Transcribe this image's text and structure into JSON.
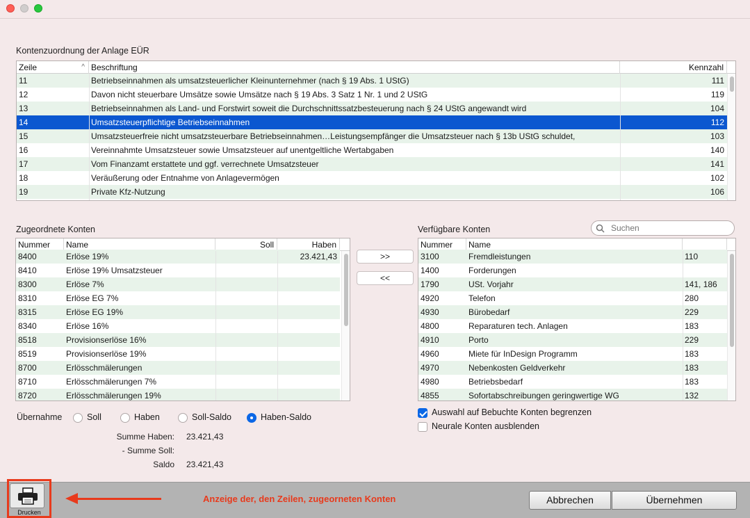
{
  "anlage": {
    "title": "Kontenzuordnung der Anlage EÜR",
    "headers": {
      "zeile": "Zeile",
      "beschriftung": "Beschriftung",
      "kennzahl": "Kennzahl"
    },
    "rows": [
      {
        "zeile": "11",
        "text": "Betriebseinnahmen als umsatzsteuerlicher Kleinunternehmer (nach § 19 Abs. 1 UStG)",
        "kz": "111"
      },
      {
        "zeile": "12",
        "text": "Davon nicht steuerbare Umsätze sowie Umsätze nach § 19 Abs. 3 Satz 1 Nr. 1 und 2 UStG",
        "kz": "119"
      },
      {
        "zeile": "13",
        "text": "Betriebseinnahmen als Land- und Forstwirt  soweit die Durchschnittssatzbesteuerung nach § 24 UStG angewandt wird",
        "kz": "104"
      },
      {
        "zeile": "14",
        "text": "Umsatzsteuerpflichtige Betriebseinnahmen",
        "kz": "112",
        "selected": true
      },
      {
        "zeile": "15",
        "text": "Umsatzsteuerfreie  nicht umsatzsteuerbare Betriebseinnahmen…Leistungsempfänger die Umsatzsteuer nach § 13b UStG schuldet,",
        "kz": "103"
      },
      {
        "zeile": "16",
        "text": "Vereinnahmte Umsatzsteuer sowie Umsatzsteuer auf unentgeltliche Wertabgaben",
        "kz": "140"
      },
      {
        "zeile": "17",
        "text": "Vom Finanzamt erstattete und ggf. verrechnete Umsatzsteuer",
        "kz": "141"
      },
      {
        "zeile": "18",
        "text": "Veräußerung oder Entnahme von Anlagevermögen",
        "kz": "102"
      },
      {
        "zeile": "19",
        "text": "Private Kfz-Nutzung",
        "kz": "106"
      }
    ]
  },
  "zugeordnet": {
    "title": "Zugeordnete Konten",
    "headers": {
      "nummer": "Nummer",
      "name": "Name",
      "soll": "Soll",
      "haben": "Haben"
    },
    "rows": [
      {
        "nummer": "8400",
        "name": "Erlöse 19%",
        "soll": "",
        "haben": "23.421,43"
      },
      {
        "nummer": "8410",
        "name": "Erlöse 19% Umsatzsteuer",
        "soll": "",
        "haben": ""
      },
      {
        "nummer": "8300",
        "name": "Erlöse 7%",
        "soll": "",
        "haben": ""
      },
      {
        "nummer": "8310",
        "name": "Erlöse EG 7%",
        "soll": "",
        "haben": ""
      },
      {
        "nummer": "8315",
        "name": "Erlöse EG 19%",
        "soll": "",
        "haben": ""
      },
      {
        "nummer": "8340",
        "name": "Erlöse 16%",
        "soll": "",
        "haben": ""
      },
      {
        "nummer": "8518",
        "name": "Provisionserlöse 16%",
        "soll": "",
        "haben": ""
      },
      {
        "nummer": "8519",
        "name": "Provisionserlöse 19%",
        "soll": "",
        "haben": ""
      },
      {
        "nummer": "8700",
        "name": "Erlösschmälerungen",
        "soll": "",
        "haben": ""
      },
      {
        "nummer": "8710",
        "name": "Erlösschmälerungen 7%",
        "soll": "",
        "haben": ""
      },
      {
        "nummer": "8720",
        "name": "Erlösschmälerungen 19%",
        "soll": "",
        "haben": ""
      }
    ]
  },
  "verfuegbar": {
    "title": "Verfügbare Konten",
    "search_placeholder": "Suchen",
    "headers": {
      "nummer": "Nummer",
      "name": "Name",
      "extra": ""
    },
    "rows": [
      {
        "nummer": "3100",
        "name": "Fremdleistungen",
        "kz": "110"
      },
      {
        "nummer": "1400",
        "name": "Forderungen",
        "kz": ""
      },
      {
        "nummer": "1790",
        "name": "USt. Vorjahr",
        "kz": "141, 186"
      },
      {
        "nummer": "4920",
        "name": "Telefon",
        "kz": "280"
      },
      {
        "nummer": "4930",
        "name": "Bürobedarf",
        "kz": "229"
      },
      {
        "nummer": "4800",
        "name": "Reparaturen tech. Anlagen",
        "kz": "183"
      },
      {
        "nummer": "4910",
        "name": "Porto",
        "kz": "229"
      },
      {
        "nummer": "4960",
        "name": "Miete für InDesign Programm",
        "kz": "183"
      },
      {
        "nummer": "4970",
        "name": "Nebenkosten Geldverkehr",
        "kz": "183"
      },
      {
        "nummer": "4980",
        "name": "Betriebsbedarf",
        "kz": "183"
      },
      {
        "nummer": "4855",
        "name": "Sofortabschreibungen geringwertige WG",
        "kz": "132"
      }
    ]
  },
  "transfer": {
    "add": ">>",
    "remove": "<<"
  },
  "uebernahme": {
    "label": "Übernahme",
    "options": [
      "Soll",
      "Haben",
      "Soll-Saldo",
      "Haben-Saldo"
    ],
    "selected": "Haben-Saldo"
  },
  "checkboxes": [
    {
      "label": "Auswahl auf Bebuchte Konten begrenzen",
      "checked": true
    },
    {
      "label": "Neurale Konten ausblenden",
      "checked": false
    }
  ],
  "summen": [
    {
      "label": "Summe Haben:",
      "value": "23.421,43"
    },
    {
      "label": "- Summe Soll:",
      "value": ""
    },
    {
      "label": "Saldo",
      "value": "23.421,43"
    }
  ],
  "footer": {
    "print_label": "Drucken",
    "annotation": "Anzeige der, den Zeilen, zugeorneten Konten",
    "cancel": "Abbrechen",
    "apply": "Übernehmen"
  },
  "colors": {
    "selection": "#0b57d0",
    "alt_row": "#e8f3ea",
    "annotation": "#e83a1c"
  }
}
